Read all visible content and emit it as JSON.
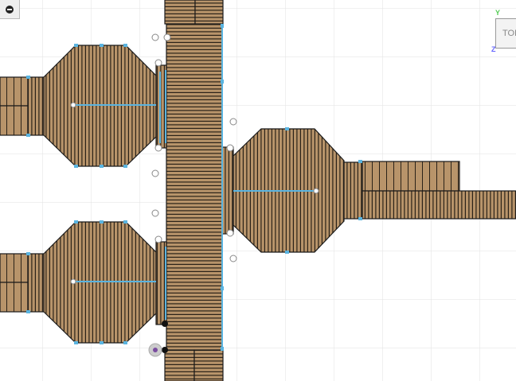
{
  "viewcube": {
    "face_label": "TOP"
  },
  "axes": {
    "y_label": "Y",
    "z_label": "Z"
  },
  "colors": {
    "wood": "#b8946a",
    "plank_line": "#2a2218",
    "selection": "#5ab4e0",
    "grid": "#e2e2e2"
  }
}
